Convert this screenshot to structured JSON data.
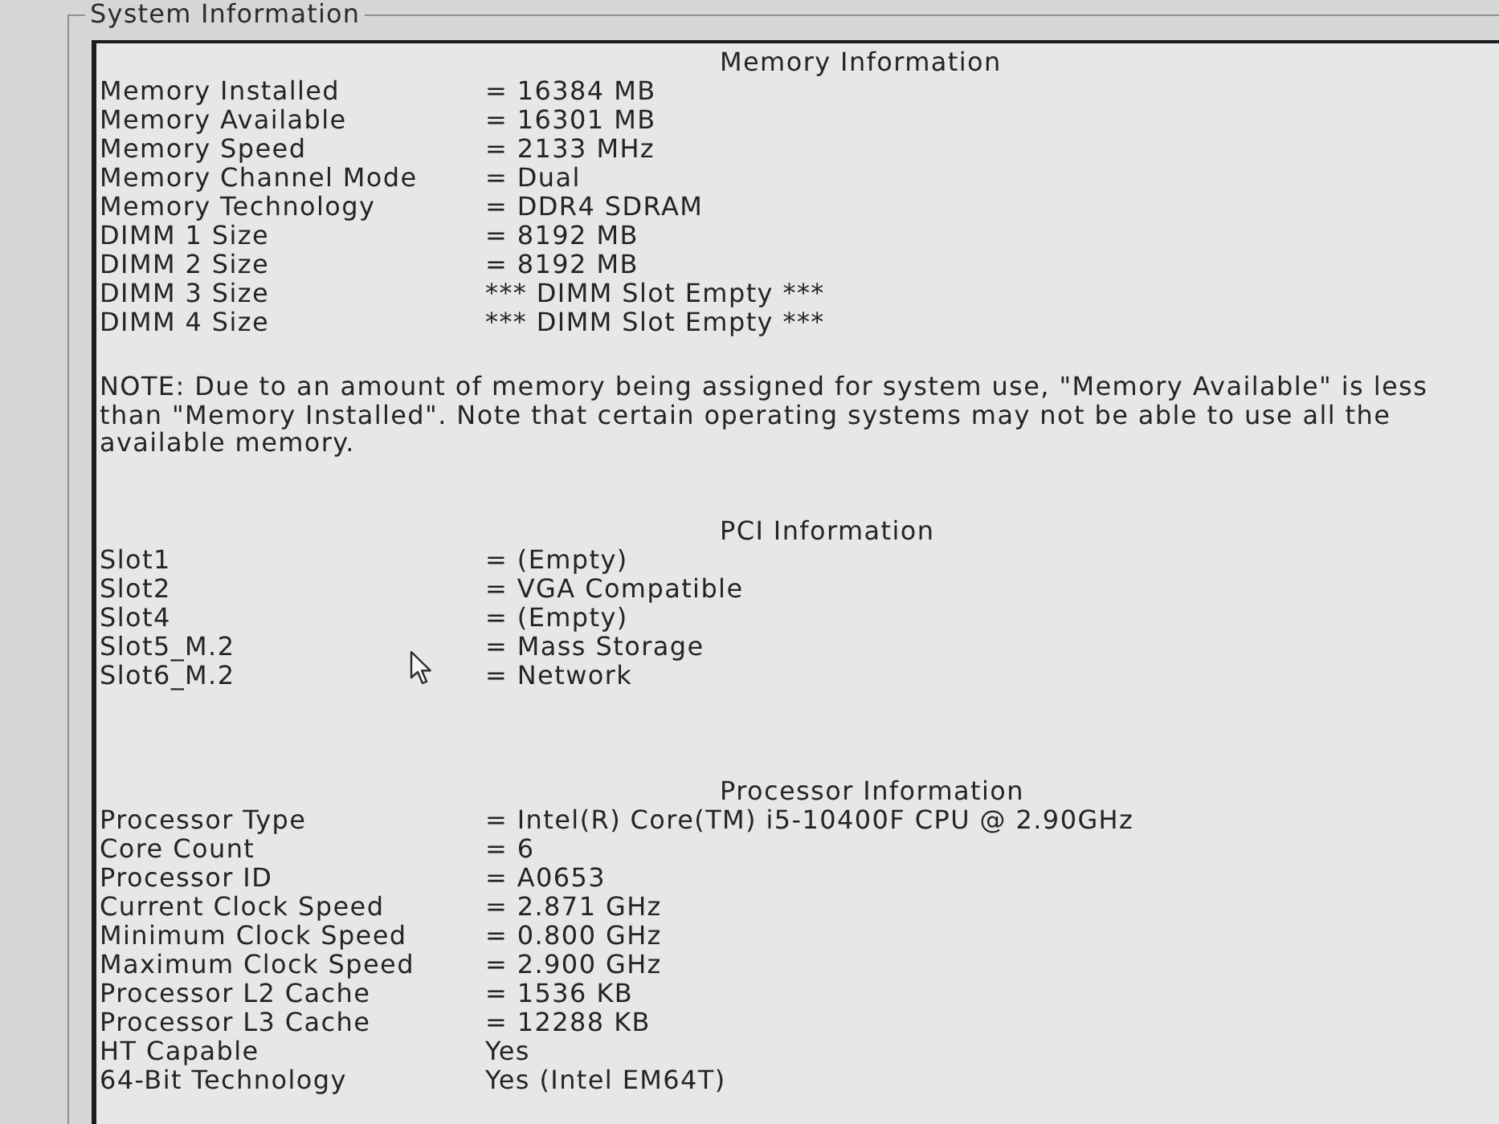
{
  "group_box": {
    "title": "System Information"
  },
  "sections": [
    {
      "heading": "Memory Information",
      "rows": [
        {
          "label": "Memory Installed",
          "value": "= 16384 MB"
        },
        {
          "label": "Memory Available",
          "value": "= 16301 MB"
        },
        {
          "label": "Memory Speed",
          "value": "= 2133 MHz"
        },
        {
          "label": "Memory Channel Mode",
          "value": "= Dual"
        },
        {
          "label": "Memory Technology",
          "value": "= DDR4 SDRAM"
        },
        {
          "label": "DIMM 1 Size",
          "value": "= 8192 MB"
        },
        {
          "label": "DIMM 2 Size",
          "value": "= 8192 MB"
        },
        {
          "label": "DIMM 3 Size",
          "value": "*** DIMM Slot Empty ***"
        },
        {
          "label": "DIMM 4 Size",
          "value": "*** DIMM Slot Empty ***"
        }
      ],
      "note": "NOTE: Due to an amount of memory being assigned for system use, \"Memory Available\" is less than \"Memory Installed\". Note that certain operating systems may not be able to use all the available memory."
    },
    {
      "heading": "PCI Information",
      "rows": [
        {
          "label": "Slot1",
          "value": "= (Empty)"
        },
        {
          "label": "Slot2",
          "value": "= VGA Compatible"
        },
        {
          "label": "Slot4",
          "value": "= (Empty)"
        },
        {
          "label": "Slot5_M.2",
          "value": "= Mass Storage"
        },
        {
          "label": "Slot6_M.2",
          "value": "= Network"
        }
      ]
    },
    {
      "heading": "Processor Information",
      "rows": [
        {
          "label": "Processor Type",
          "value": "= Intel(R) Core(TM) i5-10400F CPU @ 2.90GHz"
        },
        {
          "label": "Core Count",
          "value": "= 6"
        },
        {
          "label": "Processor ID",
          "value": "= A0653"
        },
        {
          "label": "Current Clock Speed",
          "value": "= 2.871 GHz"
        },
        {
          "label": "Minimum Clock Speed",
          "value": "= 0.800 GHz"
        },
        {
          "label": "Maximum Clock Speed",
          "value": "= 2.900 GHz"
        },
        {
          "label": "Processor L2 Cache",
          "value": "= 1536 KB"
        },
        {
          "label": "Processor L3 Cache",
          "value": "= 12288 KB"
        },
        {
          "label": "HT Capable",
          "value": "Yes"
        },
        {
          "label": "64-Bit Technology",
          "value": "Yes (Intel EM64T)"
        }
      ]
    }
  ]
}
